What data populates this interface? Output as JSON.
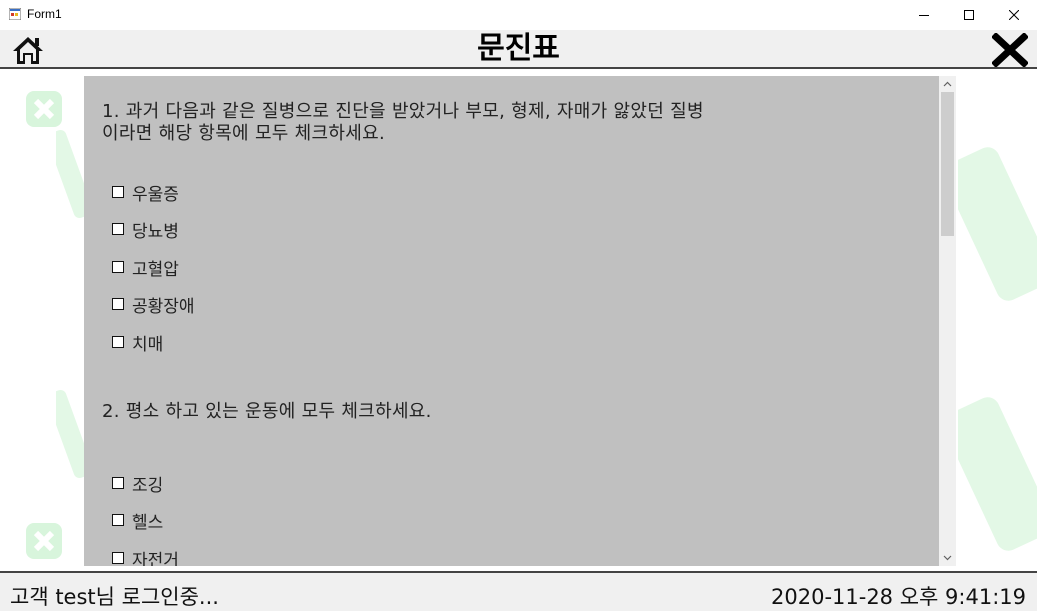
{
  "window": {
    "title": "Form1",
    "minimize_icon": "minimize-icon",
    "maximize_icon": "maximize-icon",
    "close_icon": "close-icon"
  },
  "header": {
    "title": "문진표",
    "home_icon": "home-icon",
    "close_icon": "x-close-icon"
  },
  "survey": {
    "q1": {
      "text": "1. 과거 다음과 같은 질병으로 진단을 받았거나 부모, 형제, 자매가 앓았던 질병\n이라면 해당 항목에 모두 체크하세요.",
      "options": [
        {
          "label": "우울증",
          "checked": false
        },
        {
          "label": "당뇨병",
          "checked": false
        },
        {
          "label": "고혈압",
          "checked": false
        },
        {
          "label": "공황장애",
          "checked": false
        },
        {
          "label": "치매",
          "checked": false
        }
      ]
    },
    "q2": {
      "text": "2. 평소 하고 있는 운동에 모두 체크하세요.",
      "options": [
        {
          "label": "조깅",
          "checked": false
        },
        {
          "label": "헬스",
          "checked": false
        },
        {
          "label": "자전거",
          "checked": false
        }
      ]
    }
  },
  "status": {
    "user_text": "고객 test님 로그인중...",
    "datetime": "2020-11-28 오후 9:41:19"
  },
  "colors": {
    "panel_bg": "#c0c0c0",
    "bar_bg": "#f0f0f0",
    "watermark": "#d8f5dc"
  }
}
